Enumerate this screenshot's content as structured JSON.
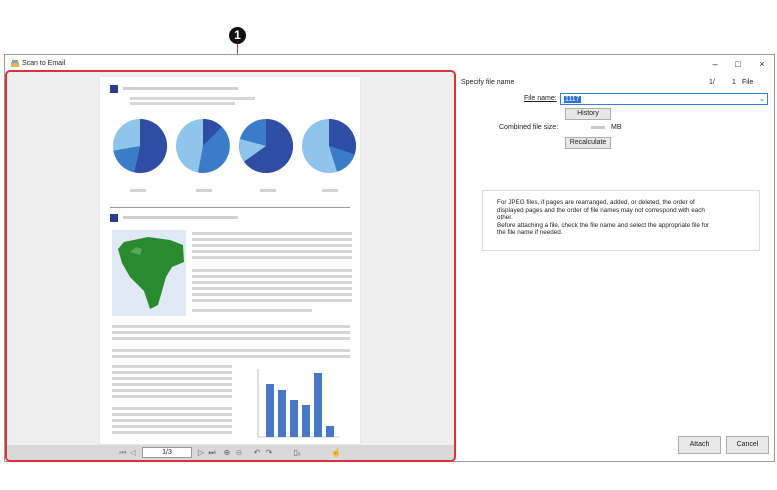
{
  "callout": {
    "number": "1"
  },
  "window": {
    "title": "Scan to Email",
    "minimize_icon": "–",
    "maximize_icon": "□",
    "close_icon": "×"
  },
  "preview": {
    "page_indicator": "1/3",
    "toolbar_icons": [
      "first-page-icon",
      "prev-page-icon",
      "next-page-icon",
      "last-page-icon",
      "zoom-in-icon",
      "zoom-out-icon",
      "rotate-left-icon",
      "rotate-right-icon",
      "delete-page-icon",
      "edit-icon"
    ],
    "glyphs": {
      "first": "⏮",
      "prev": "◁",
      "next": "▷",
      "last": "⏭",
      "zoom_in": "⊕",
      "zoom_out": "⊖",
      "rot_l": "↶",
      "rot_r": "↷",
      "del": "▯ₓ",
      "edit": "☝"
    }
  },
  "form": {
    "specify_label": "Specify file name",
    "file_count_current": "1/",
    "file_count_total": "1",
    "file_count_unit": "File",
    "file_name_label": "File name:",
    "file_name_value": "1117",
    "history_button": "History",
    "combined_size_label": "Combined file size:",
    "combined_size_unit": "MB",
    "recalculate_button": "Recalculate",
    "info_lines": [
      "For JPEG files, if pages are rearranged, added, or deleted, the order of",
      "displayed pages and the order of file names may not correspond with each",
      "other.",
      "Before attaching a file, check the file name and select the appropriate file for",
      "the file name if needed."
    ],
    "attach_button": "Attach",
    "cancel_button": "Cancel"
  },
  "colors": {
    "accent_red": "#d9343b",
    "pie_dark": "#2f4da3",
    "pie_mid": "#3b7cc9",
    "pie_light": "#8fc5ea",
    "map_green": "#2a8a2e",
    "selection": "#2f6fd0"
  }
}
